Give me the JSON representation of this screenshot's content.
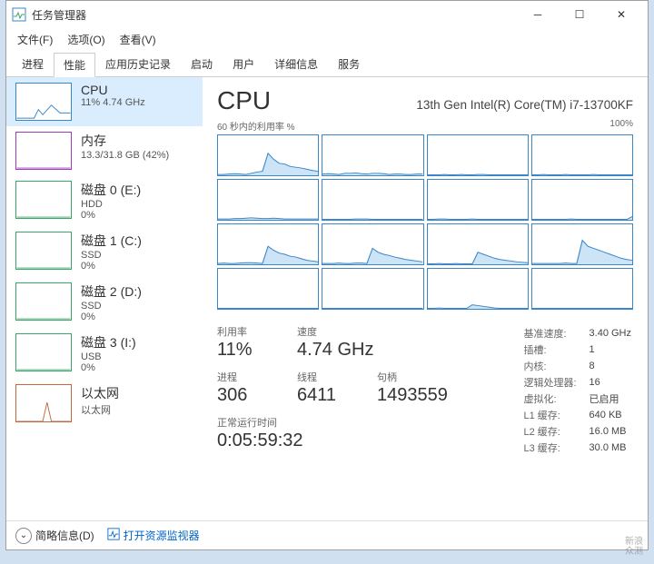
{
  "title": "任务管理器",
  "window_controls": {
    "min": "─",
    "max": "☐",
    "close": "✕"
  },
  "menubar": [
    {
      "label": "文件(F)"
    },
    {
      "label": "选项(O)"
    },
    {
      "label": "查看(V)"
    }
  ],
  "tabs": [
    {
      "label": "进程",
      "active": false
    },
    {
      "label": "性能",
      "active": true
    },
    {
      "label": "应用历史记录",
      "active": false
    },
    {
      "label": "启动",
      "active": false
    },
    {
      "label": "用户",
      "active": false
    },
    {
      "label": "详细信息",
      "active": false
    },
    {
      "label": "服务",
      "active": false
    }
  ],
  "sidebar": [
    {
      "title": "CPU",
      "sub": "11% 4.74 GHz",
      "color": "#3a86c8",
      "selected": true
    },
    {
      "title": "内存",
      "sub": "13.3/31.8 GB (42%)",
      "color": "#a03ac0"
    },
    {
      "title": "磁盘 0 (E:)",
      "sub": "HDD",
      "sub2": "0%",
      "color": "#3aa66a"
    },
    {
      "title": "磁盘 1 (C:)",
      "sub": "SSD",
      "sub2": "0%",
      "color": "#3aa66a"
    },
    {
      "title": "磁盘 2 (D:)",
      "sub": "SSD",
      "sub2": "0%",
      "color": "#3aa66a"
    },
    {
      "title": "磁盘 3 (I:)",
      "sub": "USB",
      "sub2": "0%",
      "color": "#3aa66a"
    },
    {
      "title": "以太网",
      "sub": "以太网",
      "color": "#c06a3a"
    }
  ],
  "cpu": {
    "title": "CPU",
    "model": "13th Gen Intel(R) Core(TM) i7-13700KF",
    "chart_label_left": "60 秒内的利用率 %",
    "chart_label_right": "100%"
  },
  "stats": {
    "util_label": "利用率",
    "util": "11%",
    "speed_label": "速度",
    "speed": "4.74 GHz",
    "proc_label": "进程",
    "proc": "306",
    "thread_label": "线程",
    "thread": "6411",
    "handle_label": "句柄",
    "handle": "1493559",
    "uptime_label": "正常运行时间",
    "uptime": "0:05:59:32"
  },
  "info": [
    {
      "k": "基准速度:",
      "v": "3.40 GHz"
    },
    {
      "k": "插槽:",
      "v": "1"
    },
    {
      "k": "内核:",
      "v": "8"
    },
    {
      "k": "逻辑处理器:",
      "v": "16"
    },
    {
      "k": "虚拟化:",
      "v": "已启用"
    },
    {
      "k": "L1 缓存:",
      "v": "640 KB"
    },
    {
      "k": "L2 缓存:",
      "v": "16.0 MB"
    },
    {
      "k": "L3 缓存:",
      "v": "30.0 MB"
    }
  ],
  "footer": {
    "fewer": "简略信息(D)",
    "resmon": "打开资源监视器"
  },
  "watermark": {
    "line1": "新浪",
    "line2": "众测"
  },
  "chart_data": {
    "type": "line",
    "title": "CPU 利用率 % (每核心, 近60秒)",
    "xlabel": "秒",
    "ylabel": "利用率 %",
    "ylim": [
      0,
      100
    ],
    "xlim": [
      0,
      60
    ],
    "series": [
      {
        "name": "Core 0",
        "values": [
          2,
          2,
          3,
          4,
          3,
          2,
          5,
          8,
          10,
          55,
          40,
          30,
          28,
          22,
          20,
          18,
          15,
          12,
          10
        ]
      },
      {
        "name": "Core 1",
        "values": [
          3,
          4,
          3,
          2,
          5,
          5,
          6,
          4,
          3,
          5,
          5,
          4,
          2,
          3,
          3,
          2,
          2,
          3,
          3
        ]
      },
      {
        "name": "Core 2",
        "values": [
          1,
          1,
          1,
          2,
          1,
          1,
          2,
          1,
          1,
          2,
          2,
          1,
          1,
          1,
          1,
          1,
          1,
          1,
          1
        ]
      },
      {
        "name": "Core 3",
        "values": [
          1,
          1,
          2,
          1,
          1,
          1,
          2,
          1,
          1,
          1,
          1,
          2,
          1,
          1,
          1,
          1,
          1,
          1,
          1
        ]
      },
      {
        "name": "Core 4",
        "values": [
          2,
          2,
          2,
          3,
          3,
          4,
          5,
          4,
          3,
          3,
          4,
          3,
          2,
          2,
          2,
          2,
          2,
          2,
          2
        ]
      },
      {
        "name": "Core 5",
        "values": [
          1,
          1,
          1,
          1,
          1,
          1,
          2,
          2,
          2,
          1,
          1,
          1,
          1,
          1,
          1,
          1,
          1,
          1,
          1
        ]
      },
      {
        "name": "Core 6",
        "values": [
          1,
          1,
          2,
          2,
          1,
          1,
          1,
          1,
          2,
          1,
          1,
          1,
          1,
          1,
          1,
          1,
          1,
          1,
          1
        ]
      },
      {
        "name": "Core 7",
        "values": [
          1,
          1,
          1,
          1,
          1,
          1,
          1,
          2,
          1,
          1,
          1,
          1,
          1,
          1,
          1,
          1,
          1,
          1,
          8
        ]
      },
      {
        "name": "Core 8",
        "values": [
          2,
          3,
          2,
          2,
          3,
          4,
          4,
          3,
          2,
          45,
          35,
          28,
          25,
          20,
          18,
          14,
          10,
          8,
          6
        ]
      },
      {
        "name": "Core 9",
        "values": [
          2,
          2,
          2,
          3,
          2,
          2,
          3,
          3,
          2,
          40,
          30,
          25,
          22,
          18,
          15,
          12,
          10,
          8,
          6
        ]
      },
      {
        "name": "Core 10",
        "values": [
          1,
          1,
          2,
          1,
          1,
          2,
          1,
          1,
          1,
          30,
          25,
          20,
          15,
          12,
          10,
          8,
          6,
          5,
          4
        ]
      },
      {
        "name": "Core 11",
        "values": [
          2,
          2,
          2,
          2,
          2,
          2,
          3,
          2,
          2,
          60,
          45,
          40,
          35,
          30,
          25,
          20,
          15,
          12,
          10
        ]
      },
      {
        "name": "Core 12",
        "values": [
          1,
          1,
          1,
          1,
          1,
          1,
          1,
          1,
          1,
          1,
          1,
          1,
          1,
          1,
          1,
          1,
          1,
          1,
          1
        ]
      },
      {
        "name": "Core 13",
        "values": [
          1,
          1,
          1,
          1,
          1,
          1,
          1,
          1,
          1,
          1,
          1,
          1,
          1,
          1,
          1,
          1,
          1,
          1,
          1
        ]
      },
      {
        "name": "Core 14",
        "values": [
          1,
          1,
          2,
          1,
          1,
          1,
          1,
          1,
          10,
          8,
          6,
          4,
          2,
          1,
          1,
          1,
          1,
          1,
          1
        ]
      },
      {
        "name": "Core 15",
        "values": [
          1,
          1,
          1,
          1,
          1,
          1,
          1,
          1,
          1,
          1,
          1,
          1,
          1,
          1,
          1,
          1,
          1,
          1,
          1
        ]
      }
    ]
  }
}
